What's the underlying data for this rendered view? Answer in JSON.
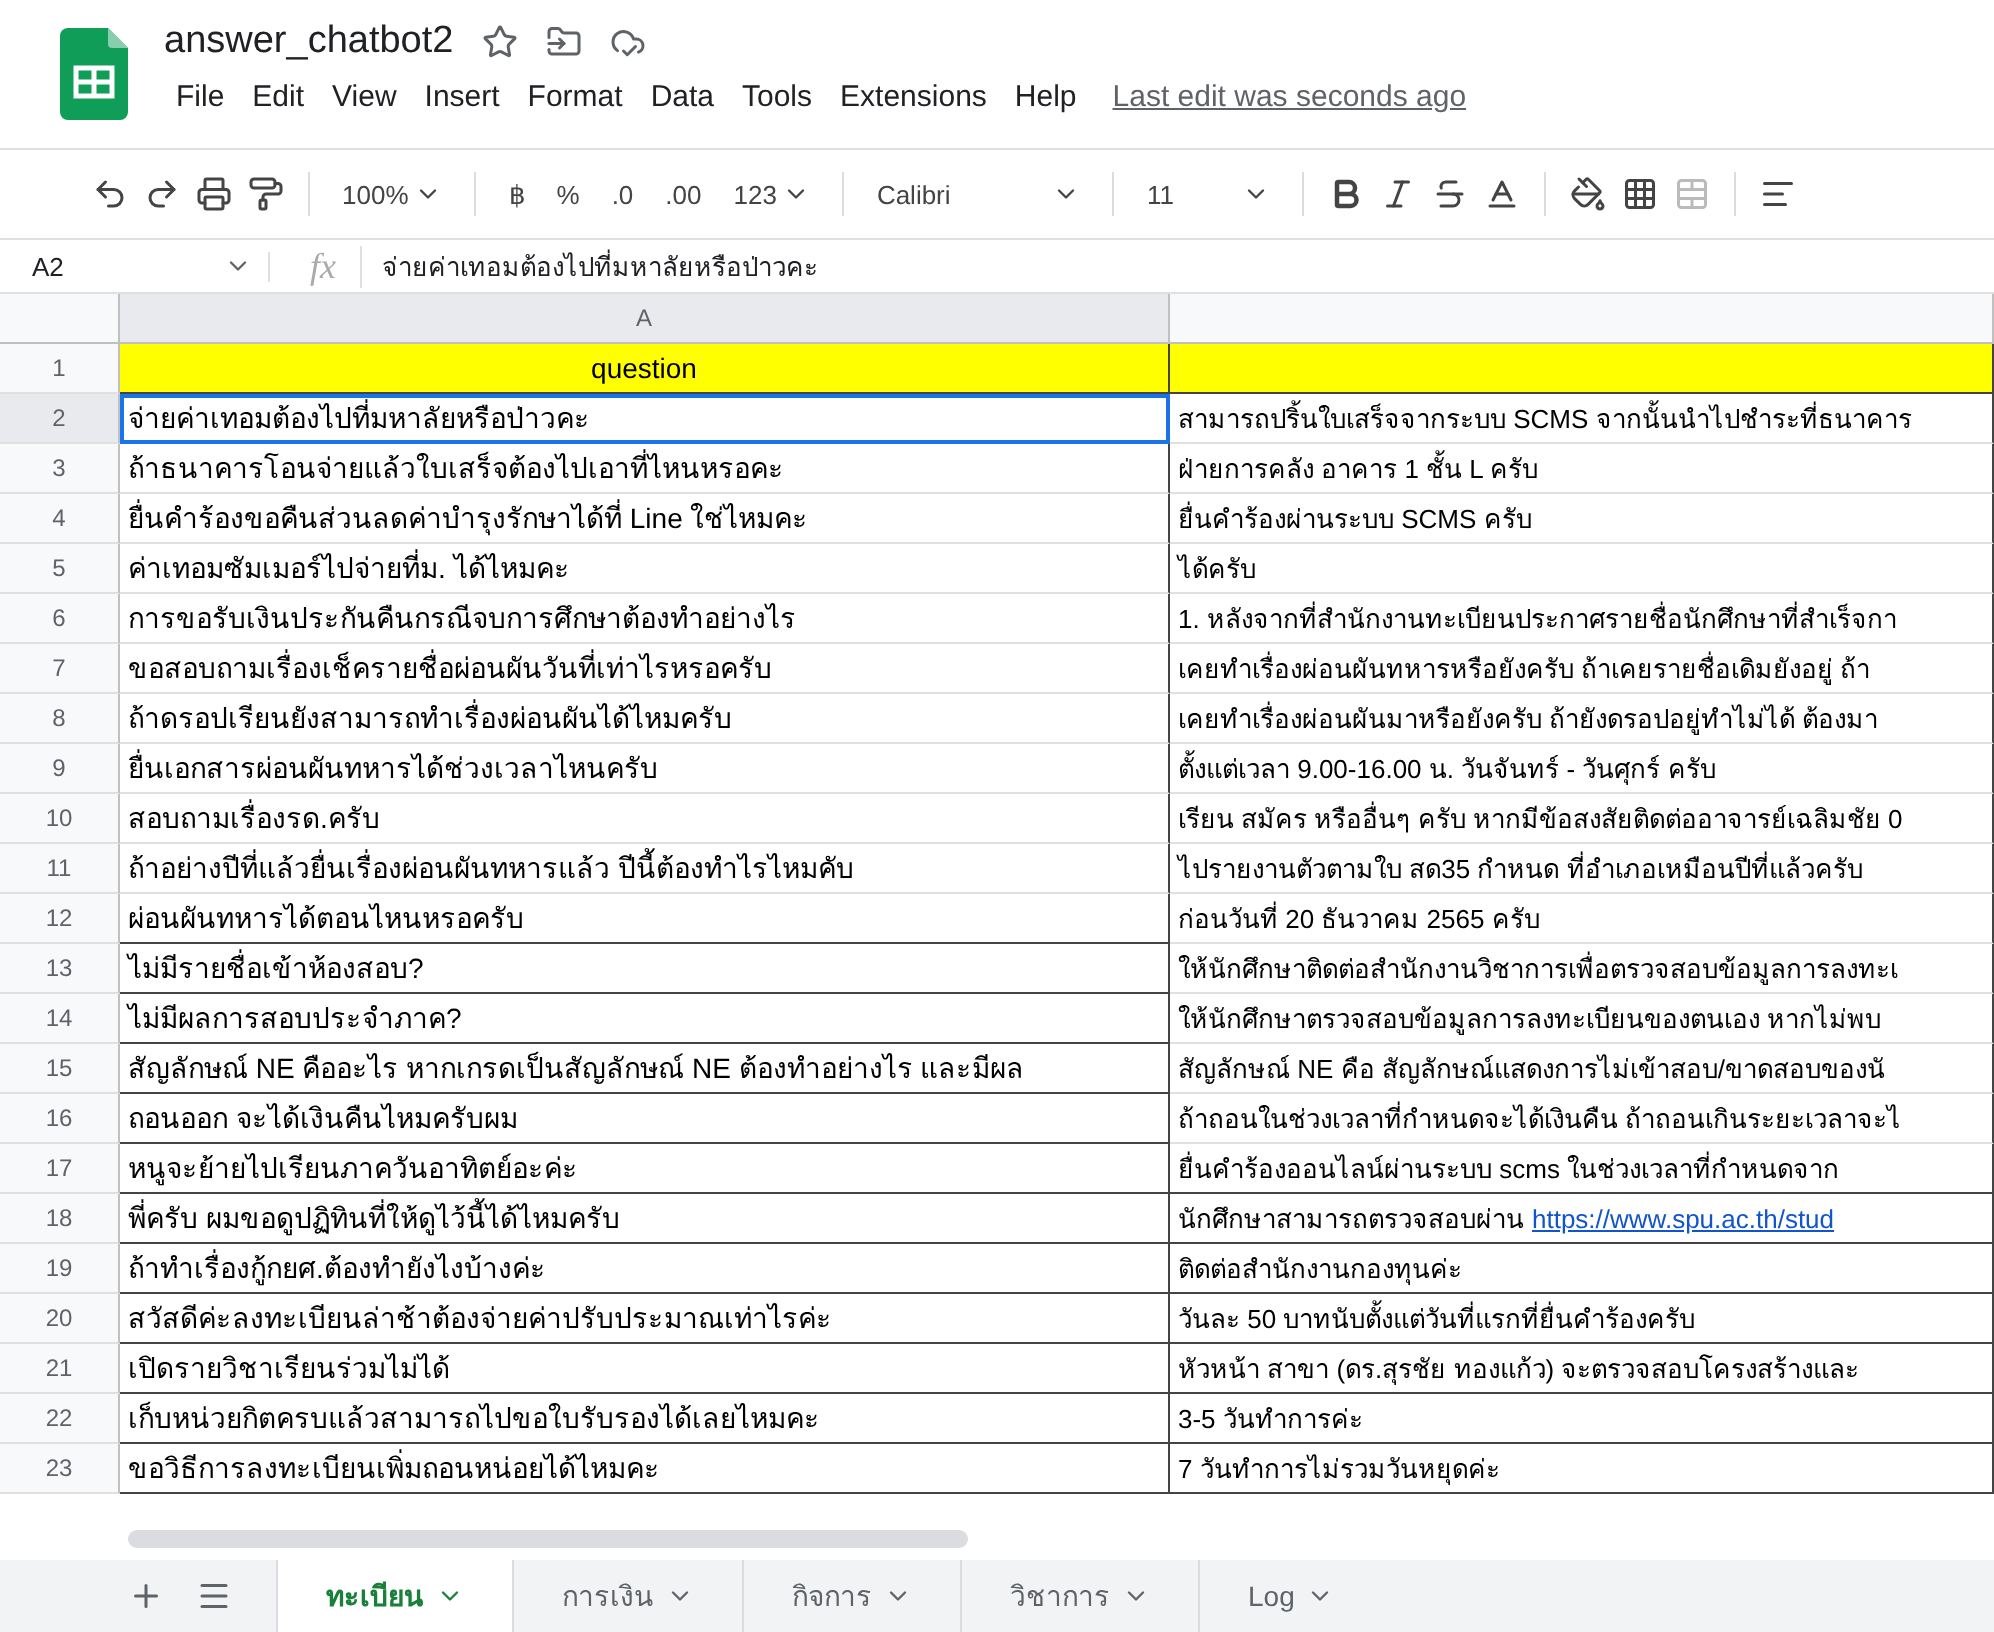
{
  "app": {
    "title": "answer_chatbot2",
    "menus": [
      "File",
      "Edit",
      "View",
      "Insert",
      "Format",
      "Data",
      "Tools",
      "Extensions",
      "Help"
    ],
    "last_edit": "Last edit was seconds ago"
  },
  "toolbar": {
    "zoom": "100%",
    "currency": "฿",
    "percent": "%",
    "decrease_decimal": ".0",
    "increase_decimal": ".00",
    "number_format": "123",
    "font": "Calibri",
    "font_size": "11"
  },
  "formula_bar": {
    "cell": "A2",
    "fx": "fx",
    "value": "จ่ายค่าเทอมต้องไปที่มหาลัยหรือป่าวคะ"
  },
  "column_headers": [
    "A"
  ],
  "header_row": {
    "number": "1",
    "question": "question"
  },
  "rows": [
    {
      "number": "2",
      "question": "จ่ายค่าเทอมต้องไปที่มหาลัยหรือป่าวคะ",
      "answer": "สามารถปริ้นใบเสร็จจากระบบ SCMS จากนั้นนำไปชำระที่ธนาคาร",
      "selected": true
    },
    {
      "number": "3",
      "question": "ถ้าธนาคารโอนจ่ายแล้วใบเสร็จต้องไปเอาที่ไหนหรอคะ",
      "answer": "ฝ่ายการคลัง อาคาร 1 ชั้น L ครับ",
      "selected": false
    },
    {
      "number": "4",
      "question": "ยื่นคำร้องขอคืนส่วนลดค่าบำรุงรักษาได้ที่ Line ใช่ไหมคะ",
      "answer": "ยื่นคำร้องผ่านระบบ SCMS ครับ",
      "selected": false
    },
    {
      "number": "5",
      "question": "ค่าเทอมซัมเมอร์ไปจ่ายที่ม. ได้ไหมคะ",
      "answer": "ได้ครับ",
      "selected": false
    },
    {
      "number": "6",
      "question": "การขอรับเงินประกันคืนกรณีจบการศึกษาต้องทำอย่างไร",
      "answer": "1. หลังจากที่สำนักงานทะเบียนประกาศรายชื่อนักศึกษาที่สำเร็จกา",
      "selected": false
    },
    {
      "number": "7",
      "question": "ขอสอบถามเรื่องเช็ครายชื่อผ่อนผันวันที่เท่าไรหรอครับ",
      "answer": "เคยทำเรื่องผ่อนผันทหารหรือยังครับ  ถ้าเคยรายชื่อเดิมยังอยู่  ถ้า",
      "selected": false
    },
    {
      "number": "8",
      "question": "ถ้าดรอปเรียนยังสามารถทำเรื่องผ่อนผันได้ไหมครับ",
      "answer": "เคยทำเรื่องผ่อนผันมาหรือยังครับ  ถ้ายังดรอปอยู่ทำไม่ได้  ต้องมา",
      "selected": false
    },
    {
      "number": "9",
      "question": "ยื่นเอกสารผ่อนผันทหารได้ช่วงเวลาไหนครับ",
      "answer": "ตั้งแต่เวลา 9.00-16.00 น. วันจันทร์ - วันศุกร์ ครับ",
      "selected": false
    },
    {
      "number": "10",
      "question": "สอบถามเรื่องรด.ครับ",
      "answer": "เรียน สมัคร หรืออื่นๆ ครับ หากมีข้อสงสัยติดต่ออาจารย์เฉลิมชัย 0",
      "selected": false
    },
    {
      "number": "11",
      "question": "ถ้าอย่างปีที่แล้วยื่นเรื่องผ่อนผันทหารแล้ว ปีนี้ต้องทำไรไหมคับ",
      "answer": "ไปรายงานตัวตามใบ สด35 กำหนด  ที่อำเภอเหมือนปีที่แล้วครับ",
      "selected": false
    },
    {
      "number": "12",
      "question": "ผ่อนผันทหารได้ตอนไหนหรอครับ",
      "answer": "ก่อนวันที่ 20 ธันวาคม 2565   ครับ",
      "selected": false
    },
    {
      "number": "13",
      "question": "ไม่มีรายชื่อเข้าห้องสอบ?",
      "answer": "ให้นักศึกษาติดต่อสำนักงานวิชาการเพื่อตรวจสอบข้อมูลการลงทะเ",
      "selected": false
    },
    {
      "number": "14",
      "question": "ไม่มีผลการสอบประจำภาค?",
      "answer": "ให้นักศึกษาตรวจสอบข้อมูลการลงทะเบียนของตนเอง หากไม่พบ",
      "selected": false
    },
    {
      "number": "15",
      "question": "สัญลักษณ์ NE คืออะไร หากเกรดเป็นสัญลักษณ์ NE ต้องทำอย่างไร และมีผล",
      "answer": "สัญลักษณ์ NE คือ สัญลักษณ์แสดงการไม่เข้าสอบ/ขาดสอบของนั",
      "selected": false
    },
    {
      "number": "16",
      "question": "ถอนออก จะได้เงินคืนไหมครับผม",
      "answer": "ถ้าถอนในช่วงเวลาที่กำหนดจะได้เงินคืน ถ้าถอนเกินระยะเวลาจะไ",
      "selected": false
    },
    {
      "number": "17",
      "question": "หนูจะย้ายไปเรียนภาควันอาทิตย์อะค่ะ",
      "answer": "ยื่นคำร้องออนไลน์ผ่านระบบ scms ในช่วงเวลาที่กำหนดจาก",
      "selected": false
    },
    {
      "number": "18",
      "question": "พี่ครับ ผมขอดูปฏิทินที่ให้ดูไว้นี้ได้ไหมครับ",
      "answer": "นักศึกษาสามารถตรวจสอบผ่าน",
      "link": "https://www.spu.ac.th/stud",
      "selected": false
    },
    {
      "number": "19",
      "question": "ถ้าทำเรื่องกู้กยศ.ต้องทำยังไงบ้างค่ะ",
      "answer": "ติดต่อสำนักงานกองทุนค่ะ",
      "selected": false
    },
    {
      "number": "20",
      "question": "สวัสดีค่ะลงทะเบียนล่าช้าต้องจ่ายค่าปรับประมาณเท่าไรค่ะ",
      "answer": "วันละ 50 บาทนับตั้งแต่วันที่แรกที่ยื่นคำร้องครับ",
      "selected": false
    },
    {
      "number": "21",
      "question": "เปิดรายวิชาเรียนร่วมไม่ได้",
      "answer": "หัวหน้า สาขา (ดร.สุรชัย ทองแก้ว) จะตรวจสอบโครงสร้างและ",
      "selected": false
    },
    {
      "number": "22",
      "question": "เก็บหน่วยกิตครบแล้วสามารถไปขอใบรับรองได้เลยไหมคะ",
      "answer": "3-5 วันทำการค่ะ",
      "selected": false
    },
    {
      "number": "23",
      "question": "ขอวิธีการลงทะเบียนเพิ่มถอนหน่อยได้ไหมคะ",
      "answer": "7 วันทำการไม่รวมวันหยุดค่ะ",
      "selected": false
    }
  ],
  "sheets": [
    {
      "label": "ทะเบียน",
      "selected": true
    },
    {
      "label": "การเงิน",
      "selected": false
    },
    {
      "label": "กิจการ",
      "selected": false
    },
    {
      "label": "วิชาการ",
      "selected": false
    },
    {
      "label": "Log",
      "selected": false
    }
  ]
}
